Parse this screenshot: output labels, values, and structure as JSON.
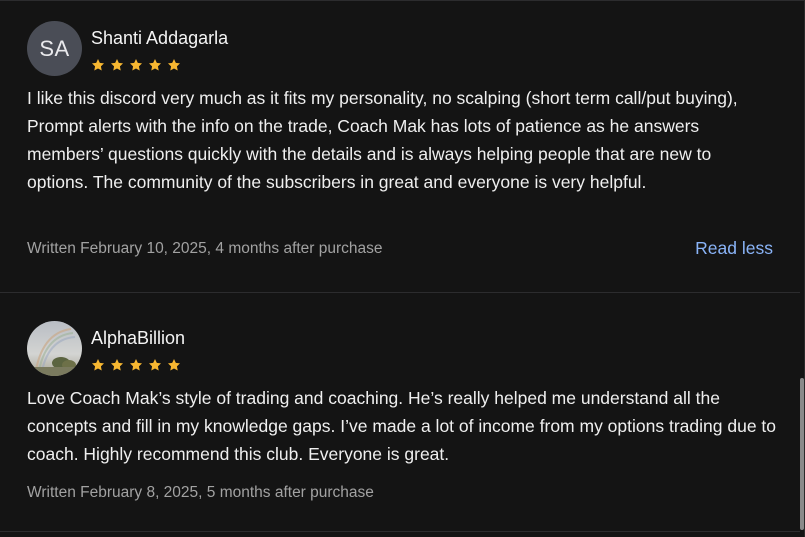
{
  "colors": {
    "background": "#141414",
    "star": "#f7b731",
    "link": "#8ab4f8",
    "meta_text": "#a2a2a2",
    "divider": "#2c2c2e"
  },
  "reviews": [
    {
      "avatar": {
        "type": "initials",
        "initials": "SA",
        "background": "#4a4d56"
      },
      "name": "Shanti Addagarla",
      "rating": 5,
      "body": "I like this discord very much as it fits my personality, no scalping (short term call/put buying), Prompt alerts with the info on the trade, Coach Mak has lots of patience as he answers members’ questions quickly with the details and is always helping people that are new to options. The community of the subscribers in great and everyone is very helpful.",
      "meta": "Written February 10, 2025, 4 months after purchase",
      "toggle_label": "Read less"
    },
    {
      "avatar": {
        "type": "photo",
        "icon": "rainbow-landscape-photo"
      },
      "name": "AlphaBillion",
      "rating": 5,
      "body": "Love Coach Mak’s style of trading and coaching. He’s really helped me understand all the concepts and fill in my knowledge gaps. I’ve made a lot of income from my options trading due to coach. Highly recommend this club. Everyone is great.",
      "meta": "Written February 8, 2025, 5 months after purchase"
    }
  ]
}
